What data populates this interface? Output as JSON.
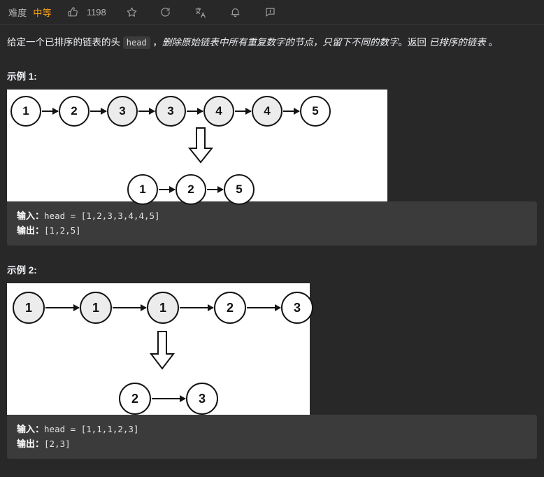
{
  "header": {
    "difficulty_label": "难度",
    "difficulty_value": "中等",
    "difficulty_color": "#ffa116",
    "like_count": "1198",
    "icons": [
      {
        "name": "thumbs-up-icon",
        "title": "点赞"
      },
      {
        "name": "star-icon",
        "title": "收藏"
      },
      {
        "name": "share-icon",
        "title": "分享"
      },
      {
        "name": "translate-icon",
        "title": "切换语言"
      },
      {
        "name": "bell-icon",
        "title": "提醒"
      },
      {
        "name": "feedback-icon",
        "title": "反馈"
      }
    ]
  },
  "description": {
    "part1": "给定一个已排序的链表的头 ",
    "code": "head",
    "part2": " ，",
    "italic1": "删除原始链表中所有重复数字的节点，只留下不同的数字",
    "part3": "。返回 ",
    "italic2": "已排序的链表",
    "part4": " 。"
  },
  "examples": [
    {
      "title": "示例 1:",
      "figure": {
        "input_list": [
          {
            "value": "1",
            "duplicate": false
          },
          {
            "value": "2",
            "duplicate": false
          },
          {
            "value": "3",
            "duplicate": true
          },
          {
            "value": "3",
            "duplicate": true
          },
          {
            "value": "4",
            "duplicate": true
          },
          {
            "value": "4",
            "duplicate": true
          },
          {
            "value": "5",
            "duplicate": false
          }
        ],
        "output_list": [
          {
            "value": "1",
            "duplicate": false
          },
          {
            "value": "2",
            "duplicate": false
          },
          {
            "value": "5",
            "duplicate": false
          }
        ]
      },
      "input_label": "输入：",
      "input_value": "head = [1,2,3,3,4,4,5]",
      "output_label": "输出：",
      "output_value": "[1,2,5]"
    },
    {
      "title": "示例 2:",
      "figure": {
        "input_list": [
          {
            "value": "1",
            "duplicate": true
          },
          {
            "value": "1",
            "duplicate": true
          },
          {
            "value": "1",
            "duplicate": true
          },
          {
            "value": "2",
            "duplicate": false
          },
          {
            "value": "3",
            "duplicate": false
          }
        ],
        "output_list": [
          {
            "value": "2",
            "duplicate": false
          },
          {
            "value": "3",
            "duplicate": false
          }
        ]
      },
      "input_label": "输入：",
      "input_value": "head = [1,1,1,2,3]",
      "output_label": "输出：",
      "output_value": "[2,3]"
    }
  ]
}
